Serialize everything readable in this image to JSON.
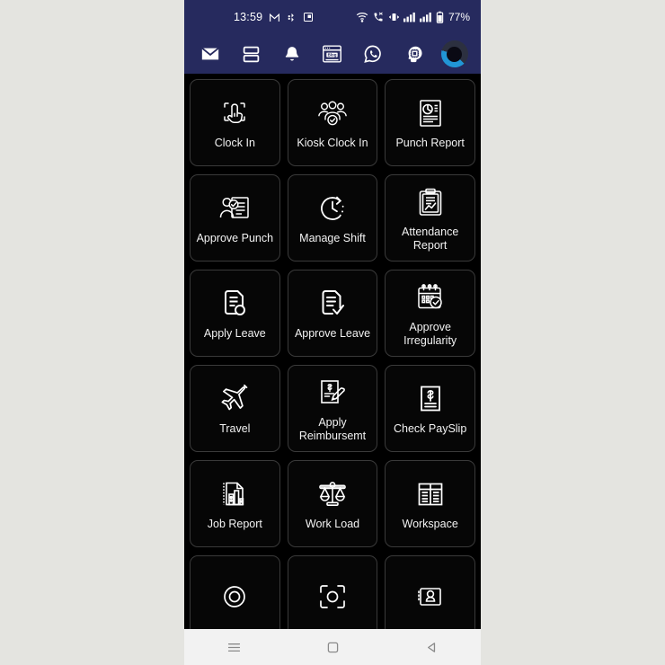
{
  "statusbar": {
    "time": "13:59",
    "battery": "77%",
    "left_icons": [
      "gmail-icon",
      "bluetooth-icon",
      "screenshot-icon"
    ],
    "right_icons": [
      "wifi-icon",
      "missed-call-icon",
      "vibrate-icon",
      "signal-1-icon",
      "signal-2-icon",
      "battery-icon"
    ],
    "bg_color": "#262a5e"
  },
  "appbar": {
    "items": [
      {
        "name": "mail-icon",
        "label": "Mail"
      },
      {
        "name": "dashboard-icon",
        "label": "Dashboard"
      },
      {
        "name": "bell-icon",
        "label": "Notifications"
      },
      {
        "name": "blog-icon",
        "label": "Blog"
      },
      {
        "name": "whatsapp-icon",
        "label": "WhatsApp"
      },
      {
        "name": "ai-head-icon",
        "label": "AI Assistant"
      },
      {
        "name": "loading-spinner",
        "label": "Loading"
      }
    ],
    "blog_text": "Blog",
    "bg_color": "#262a5e"
  },
  "grid": {
    "tiles": [
      {
        "label": "Clock In",
        "icon": "fingerprint-touch-icon"
      },
      {
        "label": "Kiosk Clock In",
        "icon": "people-group-icon"
      },
      {
        "label": "Punch Report",
        "icon": "report-chart-doc-icon"
      },
      {
        "label": "Approve Punch",
        "icon": "person-approve-icon"
      },
      {
        "label": "Manage Shift",
        "icon": "clock-arrow-icon"
      },
      {
        "label": "Attendance Report",
        "icon": "clipboard-chart-icon"
      },
      {
        "label": "Apply Leave",
        "icon": "document-circle-icon"
      },
      {
        "label": "Approve Leave",
        "icon": "document-check-icon"
      },
      {
        "label": "Approve Irregularity",
        "icon": "calendar-check-icon"
      },
      {
        "label": "Travel",
        "icon": "airplane-icon"
      },
      {
        "label": "Apply Reimbursemt",
        "icon": "invoice-pen-icon"
      },
      {
        "label": "Check PaySlip",
        "icon": "payslip-dollar-icon"
      },
      {
        "label": "Job Report",
        "icon": "bar-chart-doc-icon"
      },
      {
        "label": "Work Load",
        "icon": "balance-scale-icon"
      },
      {
        "label": "Workspace",
        "icon": "table-grid-icon"
      },
      {
        "label": "",
        "icon": "circle-partial-icon"
      },
      {
        "label": "",
        "icon": "scan-camera-icon"
      },
      {
        "label": "",
        "icon": "id-badge-icon"
      }
    ]
  },
  "androidnav": {
    "buttons": [
      {
        "name": "recents-button",
        "label": "Recents"
      },
      {
        "name": "home-button",
        "label": "Home"
      },
      {
        "name": "back-button",
        "label": "Back"
      }
    ]
  }
}
